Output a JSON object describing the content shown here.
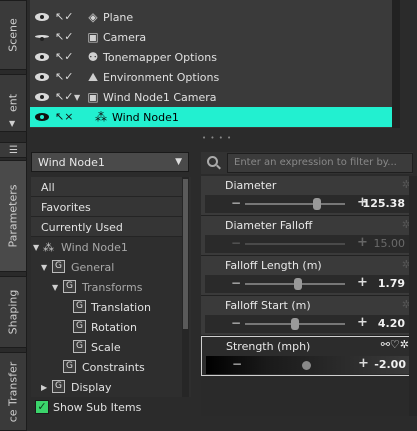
{
  "side_tabs": {
    "scene": "Scene",
    "ent": "ent",
    "parameters": "Parameters",
    "shaping": "Shaping",
    "transfer": "ce Transfer"
  },
  "scene_items": [
    {
      "name": "Plane",
      "icon": "plane-icon",
      "expander": false
    },
    {
      "name": "Camera",
      "icon": "camera-icon",
      "expander": false
    },
    {
      "name": "Tonemapper Options",
      "icon": "tonemapper-icon",
      "expander": false
    },
    {
      "name": "Environment Options",
      "icon": "environment-icon",
      "expander": false
    },
    {
      "name": "Wind Node1 Camera",
      "icon": "camera-icon",
      "expander": true
    },
    {
      "name": "Wind Node1",
      "icon": "wind-node-icon",
      "expander": false,
      "selected": true
    }
  ],
  "node_dropdown": {
    "value": "Wind Node1"
  },
  "filter": {
    "placeholder": "Enter an expression to filter by..."
  },
  "tree": {
    "all": "All",
    "favorites": "Favorites",
    "currently_used": "Currently Used",
    "node": "Wind Node1",
    "general": "General",
    "transforms": "Transforms",
    "translation": "Translation",
    "rotation": "Rotation",
    "scale": "Scale",
    "constraints": "Constraints",
    "display": "Display"
  },
  "show_sub_items": {
    "label": "Show Sub Items",
    "checked": true
  },
  "params": [
    {
      "name": "Diameter",
      "value": "125.38",
      "slider": 0.72,
      "enabled": true
    },
    {
      "name": "Diameter Falloff",
      "value": "15.00",
      "slider": 0.5,
      "enabled": false
    },
    {
      "name": "Falloff Length (m)",
      "value": "1.79",
      "slider": 0.53,
      "enabled": true
    },
    {
      "name": "Falloff Start (m)",
      "value": "4.20",
      "slider": 0.5,
      "enabled": true
    },
    {
      "name": "Strength (mph)",
      "value": "-2.00",
      "slider": 0.6,
      "enabled": true,
      "active": true
    }
  ],
  "colors": {
    "selection": "#22f0d0",
    "checkbox": "#3bd46b"
  }
}
